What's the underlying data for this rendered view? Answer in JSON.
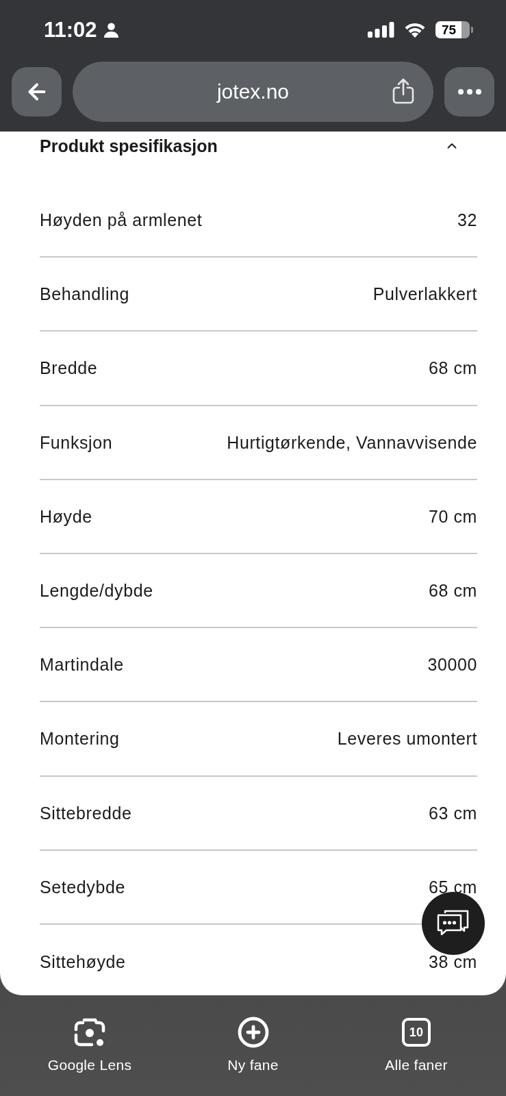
{
  "status_bar": {
    "time": "11:02",
    "battery": "75"
  },
  "browser": {
    "url": "jotex.no"
  },
  "section": {
    "title": "Produkt spesifikasjon",
    "expanded": true
  },
  "specs": [
    {
      "label": "Høyden på armlenet",
      "value": "32"
    },
    {
      "label": "Behandling",
      "value": "Pulverlakkert"
    },
    {
      "label": "Bredde",
      "value": "68 cm"
    },
    {
      "label": "Funksjon",
      "value": "Hurtigtørkende, Vannavvisende"
    },
    {
      "label": "Høyde",
      "value": "70 cm"
    },
    {
      "label": "Lengde/dybde",
      "value": "68 cm"
    },
    {
      "label": "Martindale",
      "value": "30000"
    },
    {
      "label": "Montering",
      "value": "Leveres umontert"
    },
    {
      "label": "Sittebredde",
      "value": "63 cm"
    },
    {
      "label": "Setedybde",
      "value": "65 cm"
    },
    {
      "label": "Sittehøyde",
      "value": "38 cm"
    }
  ],
  "bottom_bar": {
    "items": [
      {
        "kind": "lens",
        "label": "Google Lens"
      },
      {
        "kind": "new_tab",
        "label": "Ny fane"
      },
      {
        "kind": "tabs",
        "label": "Alle faner",
        "count": "10"
      }
    ]
  }
}
